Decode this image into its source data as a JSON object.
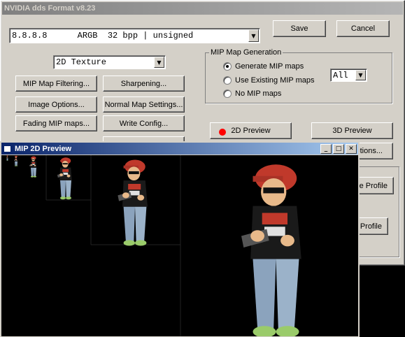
{
  "main_window": {
    "title": "NVIDIA dds Format v8.23",
    "format_combo": "8.8.8.8      ARGB  32 bpp | unsigned",
    "save_label": "Save",
    "cancel_label": "Cancel",
    "texture_type": "2D Texture",
    "buttons": {
      "mip_filtering": "MIP Map Filtering...",
      "sharpening": "Sharpening...",
      "image_options": "Image Options...",
      "normal_map": "Normal Map Settings...",
      "fading_mip": "Fading MIP maps...",
      "write_config": "Write Config..."
    },
    "mip_group": {
      "label": "MIP Map Generation",
      "options": [
        "Generate MIP maps",
        "Use Existing MIP maps",
        "No MIP maps"
      ],
      "selected_index": 0,
      "count_value": "All"
    },
    "preview_2d": "2D Preview",
    "preview_3d": "3D Preview",
    "partial": {
      "options_btn": "otions...",
      "profile_btn_1": "re Profile",
      "profile_btn_2": "Profile"
    }
  },
  "preview_window": {
    "title": "MIP 2D Preview",
    "controls": [
      "minimize",
      "maximize",
      "close"
    ]
  },
  "colors": {
    "title_active": "#0a246a",
    "title_inactive": "#808080",
    "face": "#d4d0c8",
    "indicator_red": "#ff0000"
  }
}
